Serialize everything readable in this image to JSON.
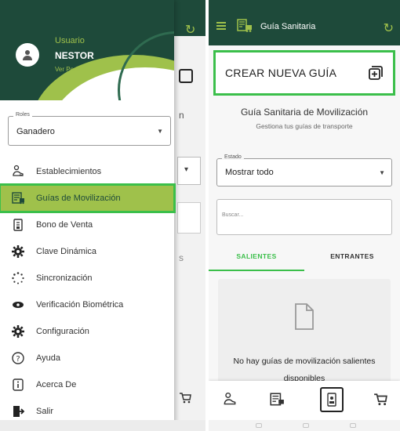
{
  "colors": {
    "primary_dark": "#1e4a3a",
    "accent_lime": "#9fc14b",
    "highlight_green": "#3bbf4a"
  },
  "drawer": {
    "user_role": "Usuario",
    "user_name": "NESTOR",
    "profile_link": "Ver Perfil",
    "roles_label": "Roles",
    "roles_value": "Ganadero",
    "items": [
      {
        "label": "Establecimientos",
        "icon": "farmer-icon"
      },
      {
        "label": "Guías de Movilización",
        "icon": "guide-truck-icon"
      },
      {
        "label": "Bono de Venta",
        "icon": "receipt-icon"
      },
      {
        "label": "Clave Dinámica",
        "icon": "gear-icon"
      },
      {
        "label": "Sincronización",
        "icon": "sync-icon"
      },
      {
        "label": "Verificación Biométrica",
        "icon": "eye-icon"
      },
      {
        "label": "Configuración",
        "icon": "gear-icon"
      },
      {
        "label": "Ayuda",
        "icon": "help-icon"
      },
      {
        "label": "Acerca De",
        "icon": "info-icon"
      },
      {
        "label": "Salir",
        "icon": "exit-icon"
      }
    ],
    "active_index": 1
  },
  "left_background": {
    "letter_a": "n",
    "letter_b": "s"
  },
  "app": {
    "title": "Guía Sanitaria",
    "create_label": "CREAR NUEVA GUÍA",
    "section_title": "Guía Sanitaria de Movilización",
    "section_subtitle": "Gestiona tus guías de transporte",
    "estado_label": "Estado",
    "estado_value": "Mostrar todo",
    "search_placeholder": "Buscar...",
    "tabs": [
      "SALIENTES",
      "ENTRANTES"
    ],
    "empty_message": "No hay guías de movilización salientes disponibles"
  },
  "bottom_nav": [
    "farmer-icon",
    "guide-truck-icon",
    "receipt-icon",
    "cart-icon"
  ]
}
